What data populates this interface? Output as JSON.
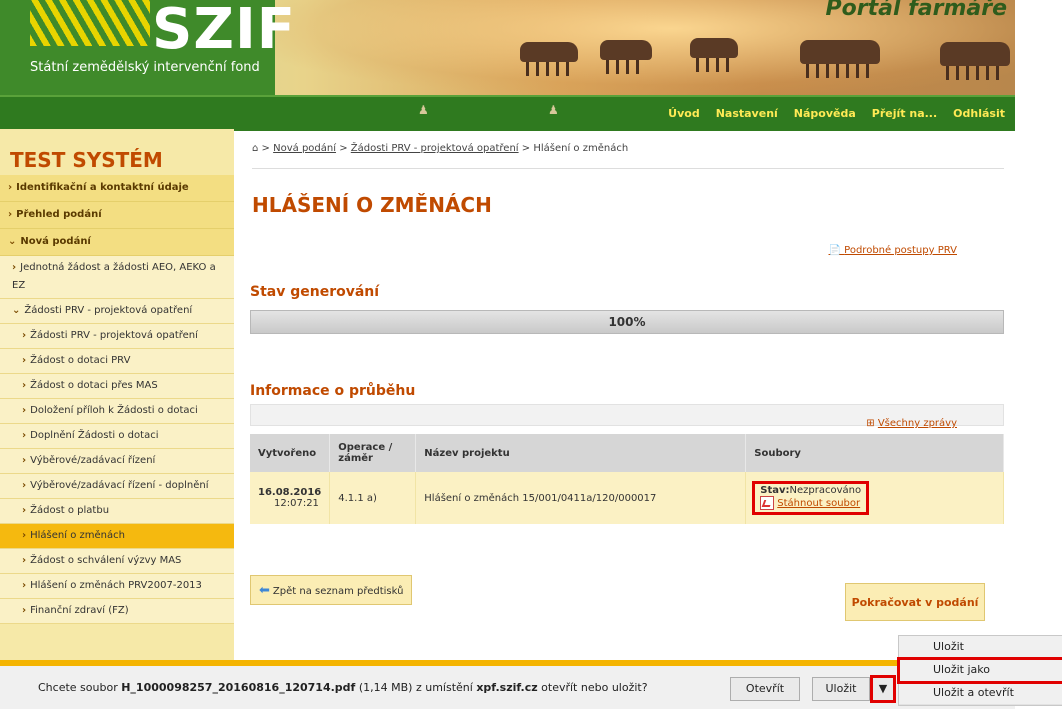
{
  "header": {
    "logo": "SZIF",
    "subtitle": "Státní zemědělský intervenční fond",
    "portal": "Portál farmáře"
  },
  "nav": {
    "items": [
      "Úvod",
      "Nastavení",
      "Nápověda",
      "Přejít na...",
      "Odhlásit"
    ]
  },
  "sidebar": {
    "title": "TEST SYSTÉM",
    "items": [
      {
        "label": "Identifikační a kontaktní údaje"
      },
      {
        "label": "Přehled podání"
      },
      {
        "label": "Nová podání"
      }
    ],
    "sub": [
      {
        "label": "Jednotná žádost a žádosti AEO, AEKO a EZ"
      },
      {
        "label": "Žádosti PRV - projektová opatření"
      }
    ],
    "sub2": [
      {
        "label": "Žádosti PRV - projektová opatření"
      },
      {
        "label": "Žádost o dotaci PRV"
      },
      {
        "label": "Žádost o dotaci přes MAS"
      },
      {
        "label": "Doložení příloh k Žádosti o dotaci"
      },
      {
        "label": "Doplnění Žádosti o dotaci"
      },
      {
        "label": "Výběrové/zadávací řízení"
      },
      {
        "label": "Výběrové/zadávací řízení - doplnění"
      },
      {
        "label": "Žádost o platbu"
      },
      {
        "label": "Hlášení o změnách"
      },
      {
        "label": "Žádost o schválení výzvy MAS"
      },
      {
        "label": "Hlášení o změnách PRV2007-2013"
      },
      {
        "label": "Finanční zdraví (FZ)"
      }
    ]
  },
  "breadcrumb": {
    "items": [
      "Nová podání",
      "Žádosti PRV - projektová opatření"
    ],
    "current": "Hlášení o změnách",
    "sep": ">"
  },
  "main": {
    "title": "HLÁŠENÍ O ZMĚNÁCH",
    "postupy_link": "Podrobné postupy PRV",
    "stav_heading": "Stav generování",
    "progress": {
      "value": 1.0,
      "label": "100%"
    },
    "info_heading": "Informace o průběhu",
    "vsechny_zpravy": "Všechny zprávy",
    "table": {
      "headers": [
        "Vytvořeno",
        "Operace / záměr",
        "Název projektu",
        "Soubory"
      ],
      "row": {
        "date": "16.08.2016",
        "time": "12:07:21",
        "operation": "4.1.1 a)",
        "project": "Hlášení o změnách 15/001/0411a/120/000017",
        "stav_label": "Stav:",
        "stav_value": "Nezpracováno",
        "download": "Stáhnout soubor"
      }
    },
    "back_button": "Zpět na seznam předtisků",
    "continue_button": "Pokračovat v podání"
  },
  "download_bar": {
    "prefix": "Chcete soubor",
    "filename": "H_1000098257_20160816_120714.pdf",
    "size": "(1,14 MB) z umístění",
    "host": "xpf.szif.cz",
    "suffix": "otevřít nebo uložit?",
    "open": "Otevřít",
    "save": "Uložit",
    "menu": [
      "Uložit",
      "Uložit jako",
      "Uložit a otevřít"
    ]
  },
  "colors": {
    "accent": "#c04a00",
    "nav_bg": "#2f7a1f",
    "nav_text": "#ffea55",
    "sidebar_bg": "#f6e9a8",
    "highlight": "#e00000"
  }
}
